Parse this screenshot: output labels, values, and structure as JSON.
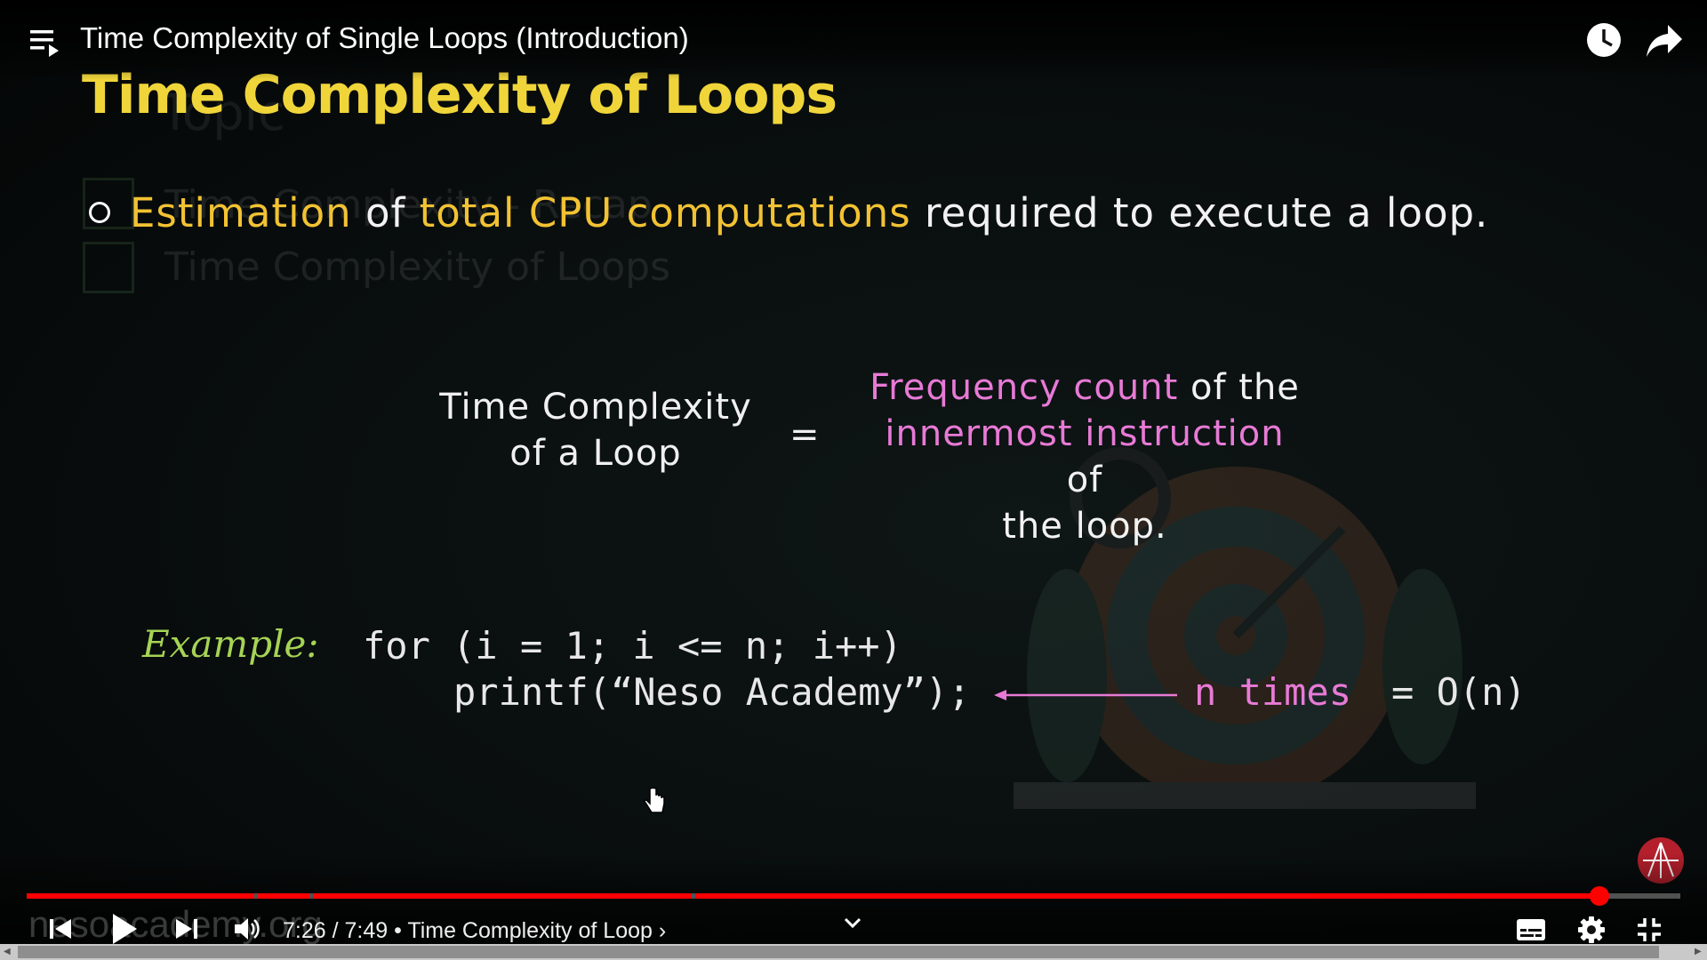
{
  "player": {
    "video_title": "Time Complexity of Single Loops (Introduction)",
    "time_display": "7:26 / 7:49 • Time Complexity of Loop ›",
    "progress_fraction": 0.951,
    "watermark": "nesoacademy.org",
    "accent_color": "#ff0000",
    "icons": [
      "playlist-icon",
      "watch-later-icon",
      "share-icon",
      "previous-icon",
      "play-icon",
      "next-icon",
      "volume-icon",
      "chevron-down-icon",
      "subtitles-icon",
      "settings-icon",
      "exit-fullscreen-icon"
    ]
  },
  "slide": {
    "title": "Time Complexity of Loops",
    "ghost_items": [
      "Time Complexity - Recap",
      "Time Complexity of Loops"
    ],
    "bullet": {
      "part1": "Estimation",
      "part2": " of ",
      "part3": "total CPU computations",
      "part4": " required to execute a loop."
    },
    "lhs_line1": "Time Complexity",
    "lhs_line2": "of a Loop",
    "equals": "=",
    "rhs": {
      "line1_pink": "Frequency count",
      "line1_white": " of the",
      "line2_pink": "innermost instruction",
      "line2_white": " of",
      "line3": "the loop."
    },
    "example_label": "Example:",
    "code_line1": "for (i = 1; i <= n; i++)",
    "code_line2": "printf(“Neso Academy”);",
    "n_times": "n times",
    "result": "= O(n)",
    "colors": {
      "title": "#f0d53a",
      "highlight": "#f2c233",
      "pink": "#e87ad6",
      "example": "#a6d455"
    }
  }
}
